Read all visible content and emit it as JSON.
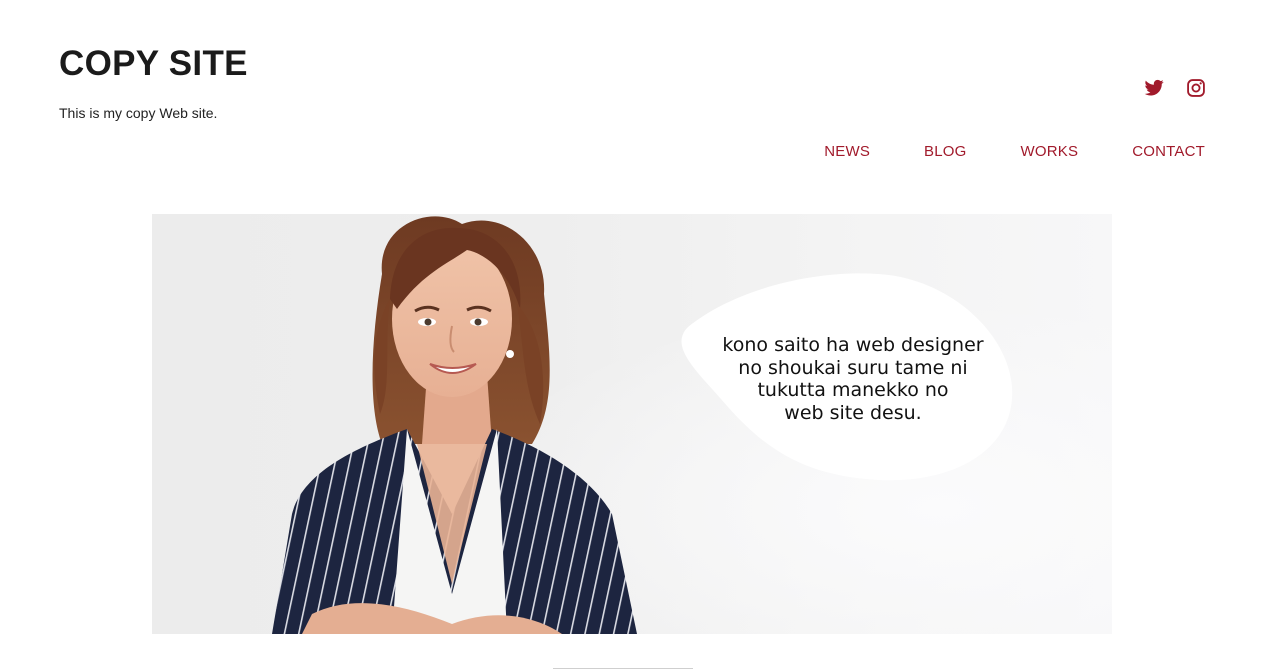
{
  "header": {
    "site_title": "COPY SITE",
    "tagline": "This is my copy Web site."
  },
  "social": [
    {
      "name": "twitter",
      "icon": "twitter-icon"
    },
    {
      "name": "instagram",
      "icon": "instagram-icon"
    }
  ],
  "nav": {
    "items": [
      "NEWS",
      "BLOG",
      "WORKS",
      "CONTACT"
    ]
  },
  "hero": {
    "bubble_text": "kono saito ha web designer\nno shoukai  suru tame ni\ntukutta manekko no\nweb site desu."
  },
  "colors": {
    "accent": "#a11a2b",
    "title": "#1b1b1b"
  }
}
